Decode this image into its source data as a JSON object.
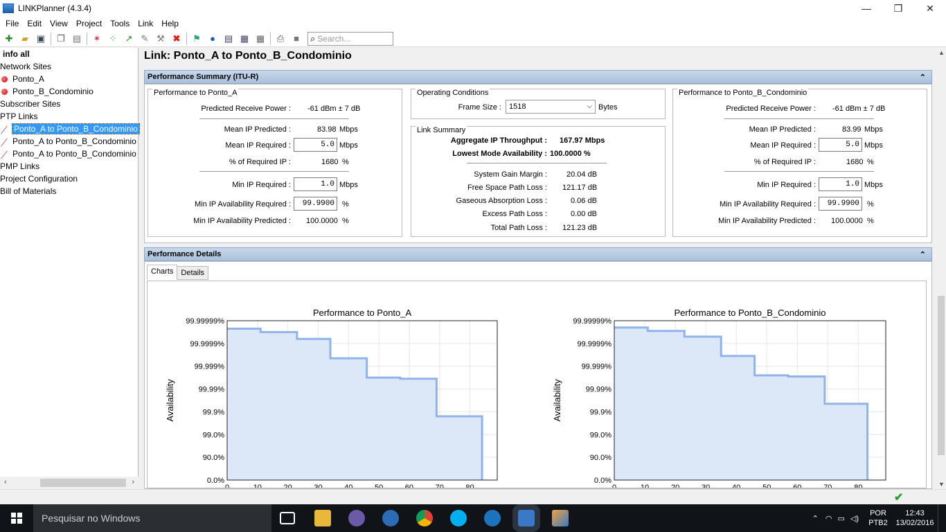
{
  "window": {
    "title": "LINKPlanner (4.3.4)",
    "minimize": "—",
    "maximize": "❐",
    "close": "✕"
  },
  "menu": [
    "File",
    "Edit",
    "View",
    "Project",
    "Tools",
    "Link",
    "Help"
  ],
  "search": {
    "placeholder": "Search..."
  },
  "tree": {
    "root": "info all",
    "network_sites": "Network Sites",
    "site_a": "Ponto_A",
    "site_b": "Ponto_B_Condominio",
    "subscriber_sites": "Subscriber Sites",
    "ptp_links": "PTP Links",
    "links": [
      "Ponto_A to Ponto_B_Condominio",
      "Ponto_A to Ponto_B_Condominio",
      "Ponto_A to Ponto_B_Condominio"
    ],
    "pmp_links": "PMP Links",
    "project_configuration": "Project Configuration",
    "bill_of_materials": "Bill of Materials"
  },
  "link_title": "Link: Ponto_A to Ponto_B_Condominio",
  "summary": {
    "header": "Performance Summary (ITU-R)",
    "left": {
      "title": "Performance to Ponto_A",
      "predicted_receive_power_label": "Predicted Receive Power :",
      "predicted_receive_power": "-61 dBm ± 7 dB",
      "mean_ip_predicted_label": "Mean IP Predicted :",
      "mean_ip_predicted": "83.98",
      "mean_ip_required_label": "Mean IP Required :",
      "mean_ip_required": "5.0",
      "pct_required_ip_label": "% of Required IP :",
      "pct_required_ip": "1680",
      "min_ip_required_label": "Min IP Required :",
      "min_ip_required": "1.0",
      "min_avail_required_label": "Min IP Availability Required :",
      "min_avail_required": "99.9900",
      "min_avail_predicted_label": "Min IP Availability Predicted :",
      "min_avail_predicted": "100.0000"
    },
    "right": {
      "title": "Performance to Ponto_B_Condominio",
      "predicted_receive_power_label": "Predicted Receive Power :",
      "predicted_receive_power": "-61 dBm ± 7 dB",
      "mean_ip_predicted_label": "Mean IP Predicted :",
      "mean_ip_predicted": "83.99",
      "mean_ip_required_label": "Mean IP Required :",
      "mean_ip_required": "5.0",
      "pct_required_ip_label": "% of Required IP :",
      "pct_required_ip": "1680",
      "min_ip_required_label": "Min IP Required :",
      "min_ip_required": "1.0",
      "min_avail_required_label": "Min IP Availability Required :",
      "min_avail_required": "99.9900",
      "min_avail_predicted_label": "Min IP Availability Predicted :",
      "min_avail_predicted": "100.0000"
    },
    "units": {
      "mbps": "Mbps",
      "pct": "%"
    },
    "operating": {
      "title": "Operating Conditions",
      "frame_size_label": "Frame Size :",
      "frame_size": "1518",
      "bytes": "Bytes"
    },
    "link_summary": {
      "title": "Link Summary",
      "agg_label": "Aggregate IP Throughput :",
      "agg_value": "167.97 Mbps",
      "lowest_label": "Lowest Mode Availability :",
      "lowest_value": "100.0000 %",
      "rows": [
        {
          "label": "System Gain Margin :",
          "value": "20.04 dB"
        },
        {
          "label": "Free Space Path Loss :",
          "value": "121.17 dB"
        },
        {
          "label": "Gaseous Absorption Loss :",
          "value": "0.06 dB"
        },
        {
          "label": "Excess Path Loss :",
          "value": "0.00 dB"
        },
        {
          "label": "Total Path Loss :",
          "value": "121.23 dB"
        }
      ]
    }
  },
  "details": {
    "header": "Performance Details",
    "tabs": [
      "Charts",
      "Details"
    ]
  },
  "chart_data": [
    {
      "type": "area",
      "title": "Performance to Ponto_A",
      "ylabel": "Availability",
      "xlabel": "",
      "xlim": [
        0,
        89
      ],
      "x_ticks": [
        0,
        10,
        20,
        30,
        40,
        50,
        60,
        70,
        80
      ],
      "y_ticks": [
        "0.0%",
        "90.0%",
        "99.0%",
        "99.9%",
        "99.99%",
        "99.999%",
        "99.9999%",
        "99.99999%"
      ],
      "x": [
        0,
        11,
        23,
        34,
        46,
        57,
        69,
        84,
        84
      ],
      "y": [
        6.65,
        6.5,
        6.2,
        5.35,
        4.5,
        4.45,
        2.8,
        2.8,
        0
      ],
      "grid": true,
      "colors": {
        "line": "#8fb3ea",
        "fill": "#dce7f7"
      }
    },
    {
      "type": "area",
      "title": "Performance to Ponto_B_Condominio",
      "ylabel": "Availability",
      "xlabel": "",
      "xlim": [
        0,
        89
      ],
      "x_ticks": [
        0,
        10,
        20,
        30,
        40,
        50,
        60,
        70,
        80
      ],
      "y_ticks": [
        "0.0%",
        "90.0%",
        "99.0%",
        "99.9%",
        "99.99%",
        "99.999%",
        "99.9999%",
        "99.99999%"
      ],
      "x": [
        0,
        11,
        23,
        35,
        46,
        57,
        69,
        83,
        83
      ],
      "y": [
        6.7,
        6.55,
        6.3,
        5.45,
        4.6,
        4.55,
        3.35,
        3.35,
        0
      ],
      "grid": true,
      "colors": {
        "line": "#8fb3ea",
        "fill": "#dce7f7"
      }
    }
  ],
  "taskbar": {
    "search_placeholder": "Pesquisar no Windows",
    "lang1": "POR",
    "lang2": "PTB2",
    "time": "12:43",
    "date": "13/02/2016"
  }
}
